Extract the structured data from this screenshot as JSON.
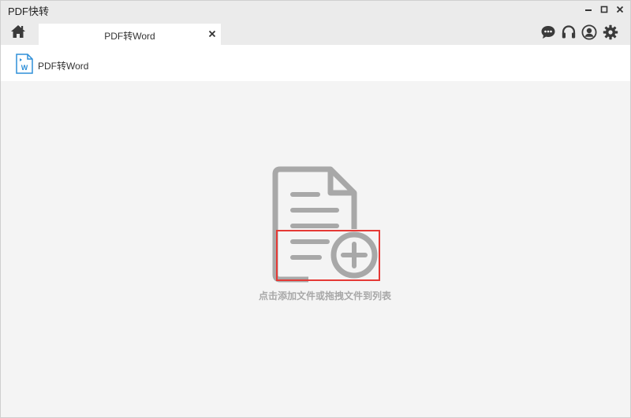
{
  "window": {
    "title": "PDF快转"
  },
  "tabs": [
    {
      "label": "PDF转Word",
      "active": true
    }
  ],
  "subheader": {
    "title": "PDF转Word",
    "badge_letter": "W"
  },
  "dropzone": {
    "hint": "点击添加文件或拖拽文件到列表"
  },
  "icons": {
    "home": "home-icon",
    "chat": "chat-icon",
    "support": "headset-icon",
    "account": "user-icon",
    "settings": "gear-icon",
    "add": "plus-circle-icon"
  },
  "colors": {
    "accent_blue": "#2f8fd8",
    "icon_dark": "#3a3a3a",
    "placeholder_gray": "#a8a8a8",
    "highlight_red": "#e53935"
  }
}
